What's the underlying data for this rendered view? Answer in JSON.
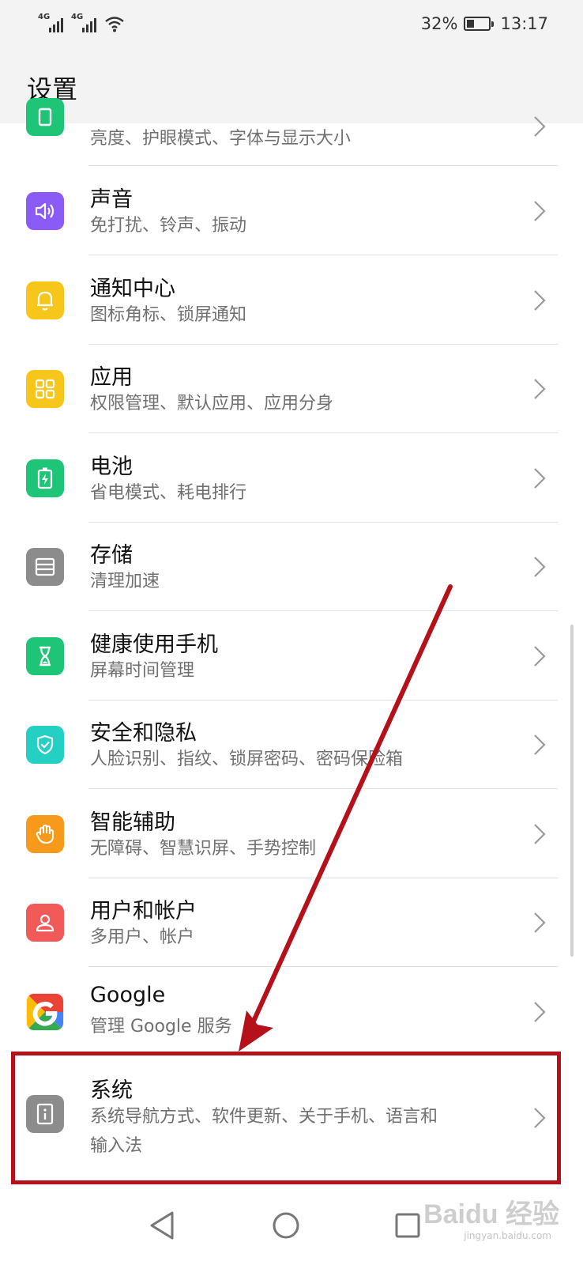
{
  "status_bar": {
    "network_1": "4G",
    "network_2": "4G",
    "battery_percent": "32%",
    "battery_level": 0.32,
    "time": "13:17"
  },
  "header": {
    "title": "设置"
  },
  "items": [
    {
      "title": "",
      "subtitle": "亮度、护眼模式、字体与显示大小",
      "icon": "display-icon",
      "color": "#1fc577"
    },
    {
      "title": "声音",
      "subtitle": "免打扰、铃声、振动",
      "icon": "speaker-icon",
      "color": "#8a5cf5"
    },
    {
      "title": "通知中心",
      "subtitle": "图标角标、锁屏通知",
      "icon": "bell-icon",
      "color": "#f7c61b"
    },
    {
      "title": "应用",
      "subtitle": "权限管理、默认应用、应用分身",
      "icon": "apps-grid-icon",
      "color": "#f7c61b"
    },
    {
      "title": "电池",
      "subtitle": "省电模式、耗电排行",
      "icon": "battery-icon",
      "color": "#1fc577"
    },
    {
      "title": "存储",
      "subtitle": "清理加速",
      "icon": "storage-icon",
      "color": "#8c8c8c"
    },
    {
      "title": "健康使用手机",
      "subtitle": "屏幕时间管理",
      "icon": "hourglass-icon",
      "color": "#1fc577"
    },
    {
      "title": "安全和隐私",
      "subtitle": "人脸识别、指纹、锁屏密码、密码保险箱",
      "icon": "shield-check-icon",
      "color": "#24cfc4"
    },
    {
      "title": "智能辅助",
      "subtitle": "无障碍、智慧识屏、手势控制",
      "icon": "hand-icon",
      "color": "#f79a1b"
    },
    {
      "title": "用户和帐户",
      "subtitle": "多用户、帐户",
      "icon": "user-icon",
      "color": "#f25a5a"
    },
    {
      "title": "Google",
      "subtitle": "管理 Google 服务",
      "icon": "google-icon",
      "color": "#ffffff"
    },
    {
      "title": "系统",
      "subtitle": "系统导航方式、软件更新、关于手机、语言和",
      "subtitle2": "输入法",
      "icon": "info-icon",
      "color": "#8c8c8c"
    }
  ],
  "watermark": {
    "brand": "Baidu 经验",
    "url": "jingyan.baidu.com"
  },
  "colors": {
    "highlight": "#b5111b",
    "arrow": "#b5111b"
  }
}
